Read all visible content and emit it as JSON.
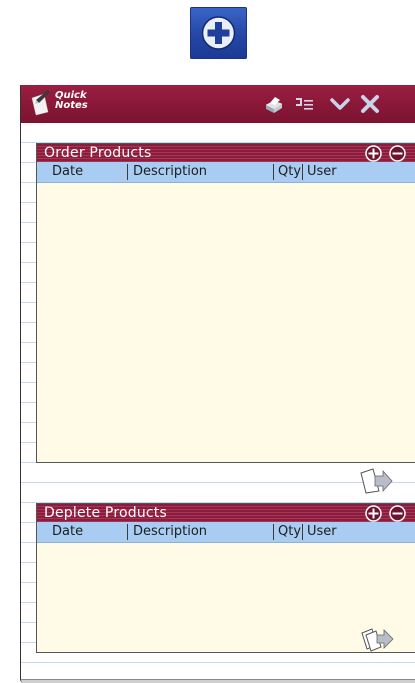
{
  "top": {
    "add_icon": "plus-icon"
  },
  "notes": {
    "app_title_line1": "Quick",
    "app_title_line2": "Notes",
    "toolbar": [
      "print-icon",
      "list-icon",
      "collapse-chevron-icon",
      "close-icon"
    ]
  },
  "order_panel": {
    "title": "Order Products",
    "columns": [
      "Date",
      "Description",
      "Qty",
      "User"
    ],
    "rows": []
  },
  "deplete_panel": {
    "title": "Deplete Products",
    "columns": [
      "Date",
      "Description",
      "Qty",
      "User"
    ],
    "rows": []
  },
  "colors": {
    "titlebar": "#8a1838",
    "column_header": "#a9cdf2",
    "panel_bg": "#fffbe6",
    "plus_bg": "#2546a6"
  }
}
